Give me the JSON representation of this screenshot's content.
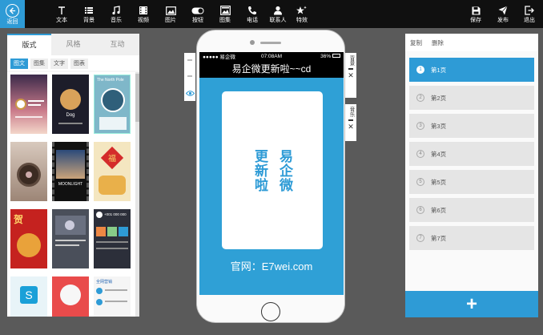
{
  "toolbar": {
    "back_label": "返回",
    "items": [
      {
        "label": "文本",
        "icon": "text-icon"
      },
      {
        "label": "背景",
        "icon": "list-icon"
      },
      {
        "label": "音乐",
        "icon": "music-icon"
      },
      {
        "label": "视频",
        "icon": "video-icon"
      },
      {
        "label": "图片",
        "icon": "image-icon"
      },
      {
        "label": "按钮",
        "icon": "toggle-icon"
      },
      {
        "label": "图集",
        "icon": "gallery-icon"
      },
      {
        "label": "电话",
        "icon": "phone-icon"
      },
      {
        "label": "联系人",
        "icon": "contact-icon"
      },
      {
        "label": "特效",
        "icon": "sparkle-icon"
      }
    ],
    "right_items": [
      {
        "label": "保存",
        "icon": "save-icon"
      },
      {
        "label": "发布",
        "icon": "send-icon"
      },
      {
        "label": "退出",
        "icon": "exit-icon"
      }
    ]
  },
  "left_panel": {
    "tabs": [
      "版式",
      "风格",
      "互动"
    ],
    "active_tab": "版式",
    "subtabs": [
      "图文",
      "图集",
      "文字",
      "图表"
    ],
    "active_subtab": "图文"
  },
  "phone": {
    "status_left": "●●●●● 易企微",
    "status_time": "07:08AM",
    "status_right": "36%",
    "title": "易企微更新啦~~cd",
    "card_col1": "易企微",
    "card_col2": "更新啦",
    "site_text": "官网：E7wei.com",
    "side_bg_label": "背景",
    "side_music_label": "音乐"
  },
  "right_panel": {
    "copy_label": "复制",
    "delete_label": "删除",
    "pages": [
      {
        "num": "1",
        "name": "第1页"
      },
      {
        "num": "2",
        "name": "第2页"
      },
      {
        "num": "3",
        "name": "第3页"
      },
      {
        "num": "4",
        "name": "第4页"
      },
      {
        "num": "5",
        "name": "第5页"
      },
      {
        "num": "6",
        "name": "第6页"
      },
      {
        "num": "7",
        "name": "第7页"
      }
    ],
    "active_page": "1",
    "add_label": "+"
  },
  "template_texts": {
    "t2": "Dog",
    "t3": "The North Pole",
    "t8": "MOONLIGHT",
    "t10": "福",
    "t11": "贺",
    "t12": "+001 000 000",
    "t15": "全网营销"
  },
  "colors": {
    "accent": "#2e9bd6",
    "toolbar_bg": "#101010",
    "workspace_bg": "#5a5a5a"
  }
}
